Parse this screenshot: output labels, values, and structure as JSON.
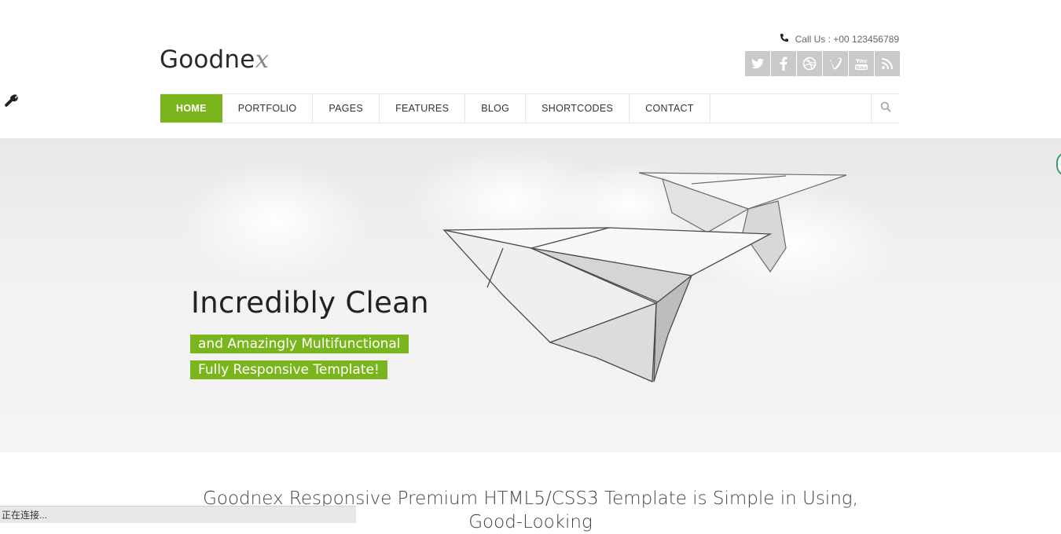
{
  "header": {
    "logo_text": "Goodne",
    "logo_swash": "x",
    "call_text": "Call Us : +00 123456789",
    "social": [
      {
        "name": "twitter",
        "glyph": "t"
      },
      {
        "name": "facebook",
        "glyph": "f"
      },
      {
        "name": "dribbble",
        "glyph": "◎"
      },
      {
        "name": "vimeo",
        "glyph": "V"
      },
      {
        "name": "youtube",
        "glyph": "You"
      },
      {
        "name": "rss",
        "glyph": "⌇"
      }
    ]
  },
  "nav": {
    "items": [
      "HOME",
      "PORTFOLIO",
      "PAGES",
      "FEATURES",
      "BLOG",
      "SHORTCODES",
      "CONTACT"
    ],
    "active": "HOME"
  },
  "hero": {
    "title": "Incredibly Clean",
    "tag1": "and Amazingly Multifunctional",
    "tag2": "Fully Responsive Template!"
  },
  "intro": {
    "text": "Goodnex Responsive Premium HTML5/CSS3 Template is Simple in Using, Good-Looking"
  },
  "status_bar": {
    "text": "正在连接..."
  },
  "colors": {
    "accent": "#7ab51d",
    "social_bg": "#c9c9c9"
  }
}
